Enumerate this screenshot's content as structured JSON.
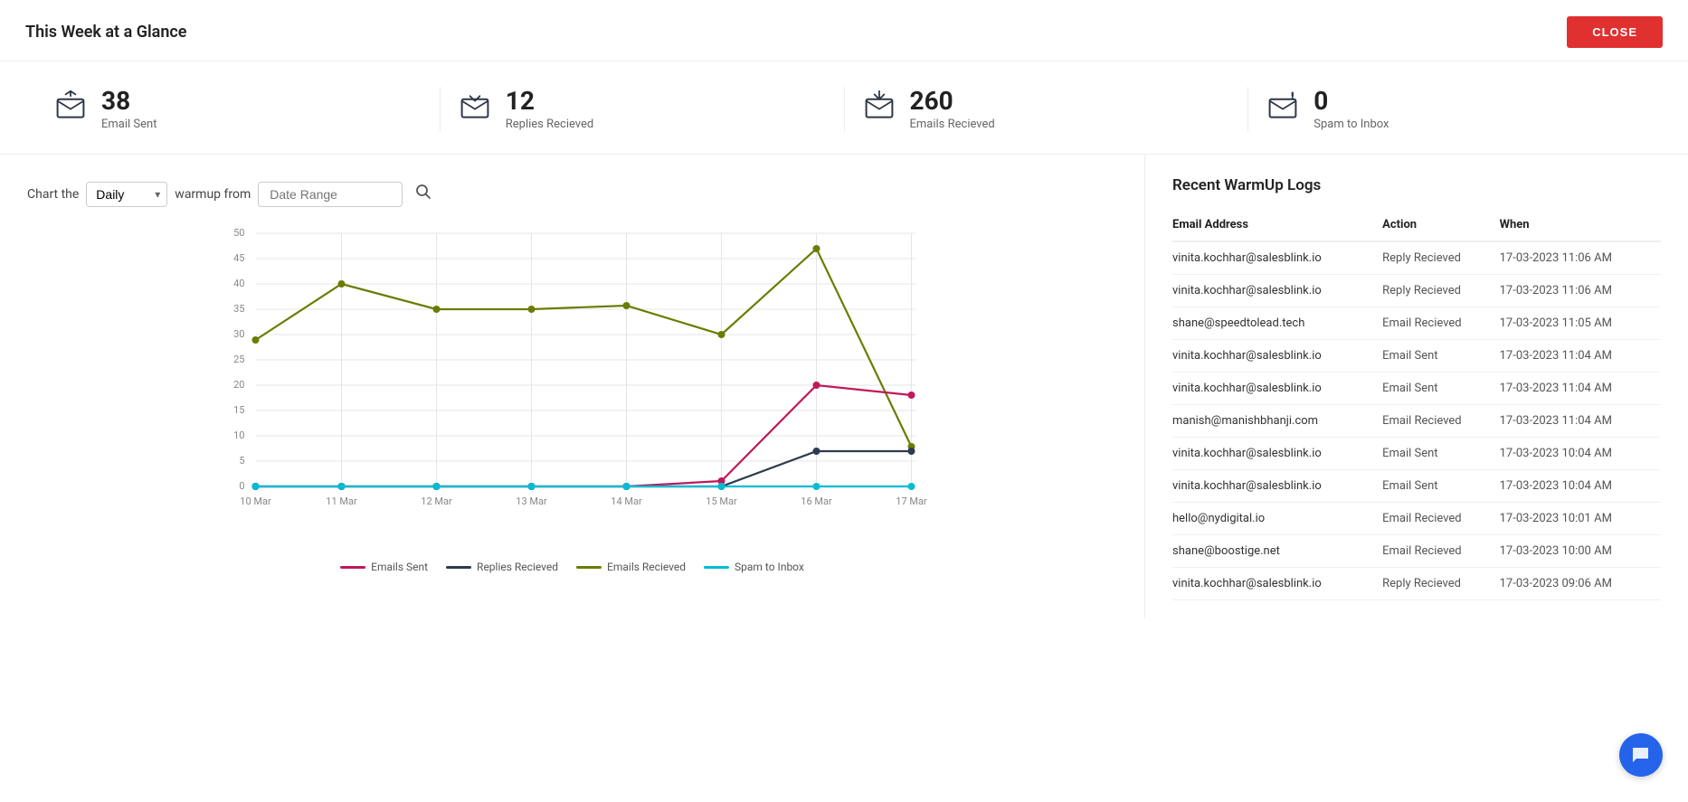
{
  "header": {
    "title": "This Week at a Glance",
    "close_label": "CLOSE"
  },
  "stats": [
    {
      "id": "email-sent",
      "icon": "email-up",
      "number": "38",
      "label": "Email Sent"
    },
    {
      "id": "replies-received",
      "icon": "email-reply",
      "number": "12",
      "label": "Replies Recieved"
    },
    {
      "id": "emails-received",
      "icon": "email-down",
      "number": "260",
      "label": "Emails Recieved"
    },
    {
      "id": "spam-to-inbox",
      "icon": "email-alert",
      "number": "0",
      "label": "Spam to Inbox"
    }
  ],
  "chart": {
    "label_chart_the": "Chart the",
    "dropdown_value": "Daily",
    "label_warmup_from": "warmup from",
    "date_range_placeholder": "Date Range",
    "x_labels": [
      "10 Mar",
      "11 Mar",
      "12 Mar",
      "13 Mar",
      "14 Mar",
      "15 Mar",
      "16 Mar",
      "17 Mar"
    ],
    "y_labels": [
      "0",
      "5",
      "10",
      "15",
      "20",
      "25",
      "30",
      "35",
      "40",
      "45",
      "50"
    ],
    "legend": [
      {
        "label": "Emails Sent",
        "color": "#c0185c"
      },
      {
        "label": "Replies Recieved",
        "color": "#2d3a50"
      },
      {
        "label": "Emails Recieved",
        "color": "#6b7c00"
      },
      {
        "label": "Spam to Inbox",
        "color": "#00bcd4"
      }
    ],
    "series": {
      "emails_sent": [
        0,
        0,
        0,
        0,
        0,
        1,
        20,
        18
      ],
      "replies_received": [
        0,
        0,
        0,
        0,
        0,
        0,
        7,
        7
      ],
      "emails_received": [
        29,
        40,
        35,
        35,
        36,
        30,
        47,
        8
      ],
      "spam_to_inbox": [
        0,
        0,
        0,
        0,
        0,
        0,
        0,
        0
      ]
    }
  },
  "logs": {
    "title": "Recent WarmUp Logs",
    "columns": [
      "Email Address",
      "Action",
      "When"
    ],
    "rows": [
      {
        "email": "vinita.kochhar@salesblink.io",
        "action": "Reply Recieved",
        "when": "17-03-2023 11:06 AM"
      },
      {
        "email": "vinita.kochhar@salesblink.io",
        "action": "Reply Recieved",
        "when": "17-03-2023 11:06 AM"
      },
      {
        "email": "shane@speedtolead.tech",
        "action": "Email Recieved",
        "when": "17-03-2023 11:05 AM"
      },
      {
        "email": "vinita.kochhar@salesblink.io",
        "action": "Email Sent",
        "when": "17-03-2023 11:04 AM"
      },
      {
        "email": "vinita.kochhar@salesblink.io",
        "action": "Email Sent",
        "when": "17-03-2023 11:04 AM"
      },
      {
        "email": "manish@manishbhanji.com",
        "action": "Email Recieved",
        "when": "17-03-2023 11:04 AM"
      },
      {
        "email": "vinita.kochhar@salesblink.io",
        "action": "Email Sent",
        "when": "17-03-2023 10:04 AM"
      },
      {
        "email": "vinita.kochhar@salesblink.io",
        "action": "Email Sent",
        "when": "17-03-2023 10:04 AM"
      },
      {
        "email": "hello@nydigital.io",
        "action": "Email Recieved",
        "when": "17-03-2023 10:01 AM"
      },
      {
        "email": "shane@boostige.net",
        "action": "Email Recieved",
        "when": "17-03-2023 10:00 AM"
      },
      {
        "email": "vinita.kochhar@salesblink.io",
        "action": "Reply Recieved",
        "when": "17-03-2023 09:06 AM"
      }
    ]
  }
}
